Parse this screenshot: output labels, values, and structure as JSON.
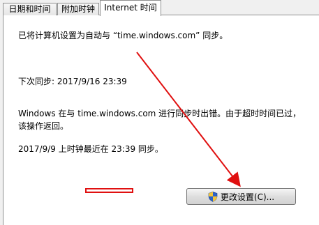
{
  "tabs": [
    {
      "label": "日期和时间"
    },
    {
      "label": "附加时钟"
    },
    {
      "label": "Internet 时间"
    }
  ],
  "content": {
    "sync_config": "已将计算机设置为自动与 “time.windows.com” 同步。",
    "next_sync": "下次同步: 2017/9/16 23:39",
    "error_line1": "Windows 在与 time.windows.com 进行同步时出错。由于超时时间已过，",
    "error_line2": "该操作返回。",
    "last_sync": "2017/9/9 上时钟最近在 23:39 同步。"
  },
  "buttons": {
    "change_settings": "更改设置(C)..."
  },
  "icons": {
    "shield": "uac-shield-icon"
  },
  "colors": {
    "annotation_red": "#e01010"
  }
}
